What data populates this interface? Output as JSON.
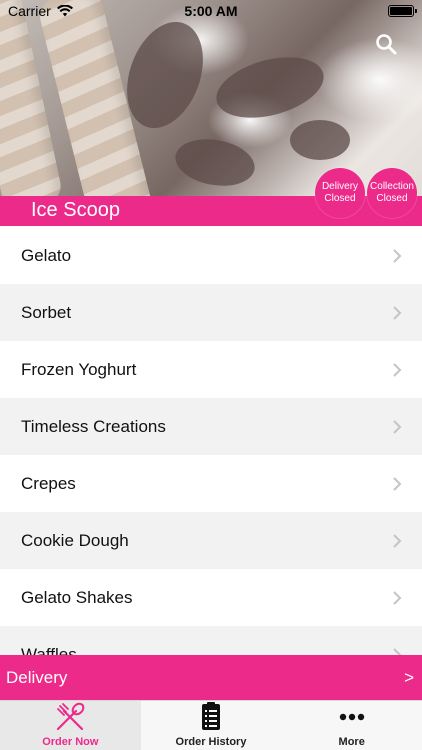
{
  "status_bar": {
    "carrier": "Carrier",
    "time": "5:00 AM"
  },
  "header": {
    "title": "Ice Scoop",
    "search_icon": "search-icon",
    "badges": {
      "delivery": {
        "line1": "Delivery",
        "line2": "Closed"
      },
      "collection": {
        "line1": "Collection",
        "line2": "Closed"
      }
    }
  },
  "menu": {
    "items": [
      {
        "label": "Gelato"
      },
      {
        "label": "Sorbet"
      },
      {
        "label": "Frozen Yoghurt"
      },
      {
        "label": "Timeless Creations"
      },
      {
        "label": "Crepes"
      },
      {
        "label": "Cookie Dough"
      },
      {
        "label": "Gelato Shakes"
      },
      {
        "label": "Waffles"
      }
    ]
  },
  "delivery_bar": {
    "label": "Delivery",
    "arrow": ">"
  },
  "tabs": [
    {
      "label": "Order Now",
      "icon": "cutlery-icon",
      "active": true
    },
    {
      "label": "Order History",
      "icon": "receipt-icon",
      "active": false
    },
    {
      "label": "More",
      "icon": "more-dots-icon",
      "active": false
    }
  ],
  "colors": {
    "accent": "#ec2a8a",
    "row_alt": "#f2f2f2",
    "tab_bar": "#f7f7f7"
  }
}
